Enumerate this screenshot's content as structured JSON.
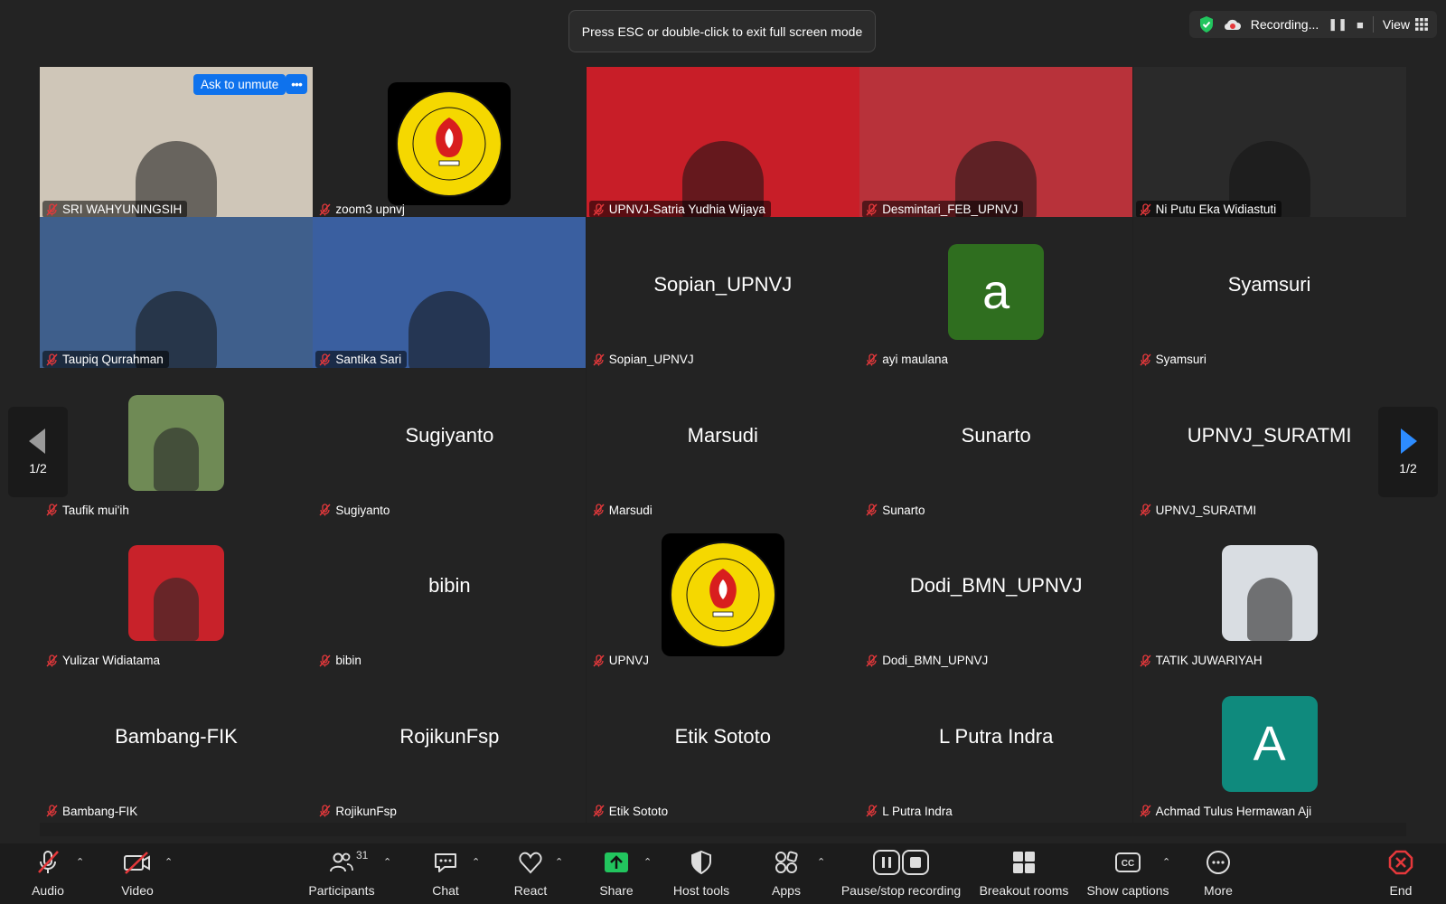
{
  "banner": {
    "esc_text": "Press ESC or double-click to exit full screen mode"
  },
  "topbar": {
    "recording_label": "Recording...",
    "view_label": "View"
  },
  "tile_controls": {
    "ask_to_unmute": "Ask to unmute",
    "more": "•••"
  },
  "pager": {
    "left_label": "1/2",
    "right_label": "1/2"
  },
  "participants": [
    {
      "name": "SRI WAHYUNINGSIH",
      "kind": "video",
      "bg": "#cfc6b8"
    },
    {
      "name": "zoom3 upnvj",
      "kind": "logo"
    },
    {
      "name": "UPNVJ-Satria Yudhia Wijaya",
      "kind": "video",
      "bg": "#c81e28"
    },
    {
      "name": "Desmintari_FEB_UPNVJ",
      "kind": "video",
      "bg": "#b8323a"
    },
    {
      "name": "Ni Putu Eka Widiastuti",
      "kind": "video",
      "bg": "#2a2a2a"
    },
    {
      "name": "Taupiq Qurrahman",
      "kind": "video",
      "bg": "#3f5f8c"
    },
    {
      "name": "Santika Sari",
      "kind": "video",
      "bg": "#3a5fa0"
    },
    {
      "name": "Sopian_UPNVJ",
      "kind": "text"
    },
    {
      "name": "ayi maulana",
      "kind": "letter",
      "letter": "a",
      "color": "#2f6e1f"
    },
    {
      "name": "Syamsuri",
      "kind": "text"
    },
    {
      "name": "Taufik mui'ih",
      "kind": "photo",
      "color": "#6f8a55"
    },
    {
      "name": "Sugiyanto",
      "kind": "text"
    },
    {
      "name": "Marsudi",
      "kind": "text"
    },
    {
      "name": "Sunarto",
      "kind": "text"
    },
    {
      "name": "UPNVJ_SURATMI",
      "kind": "text"
    },
    {
      "name": "Yulizar Widiatama",
      "kind": "photo",
      "color": "#c8222a"
    },
    {
      "name": "bibin",
      "kind": "text"
    },
    {
      "name": "UPNVJ",
      "kind": "logo"
    },
    {
      "name": "Dodi_BMN_UPNVJ",
      "kind": "text"
    },
    {
      "name": "TATIK JUWARIYAH",
      "kind": "photo",
      "color": "#d9dde2"
    },
    {
      "name": "Bambang-FIK",
      "kind": "text"
    },
    {
      "name": "RojikunFsp",
      "kind": "text"
    },
    {
      "name": "Etik Sototo",
      "kind": "text"
    },
    {
      "name": "L Putra Indra",
      "kind": "text"
    },
    {
      "name": "Achmad Tulus Hermawan Aji",
      "kind": "letter",
      "letter": "A",
      "color": "#0f8a7d"
    }
  ],
  "toolbar": {
    "audio": "Audio",
    "video": "Video",
    "participants": "Participants",
    "participant_count": "31",
    "chat": "Chat",
    "react": "React",
    "share": "Share",
    "host_tools": "Host tools",
    "apps": "Apps",
    "pause_stop_recording": "Pause/stop recording",
    "breakout_rooms": "Breakout rooms",
    "show_captions": "Show captions",
    "more": "More",
    "end": "End"
  },
  "colors": {
    "accent_blue": "#0e72ed",
    "active_speaker": "#4fd460",
    "share_green": "#22c55e",
    "end_red": "#e5383b"
  }
}
